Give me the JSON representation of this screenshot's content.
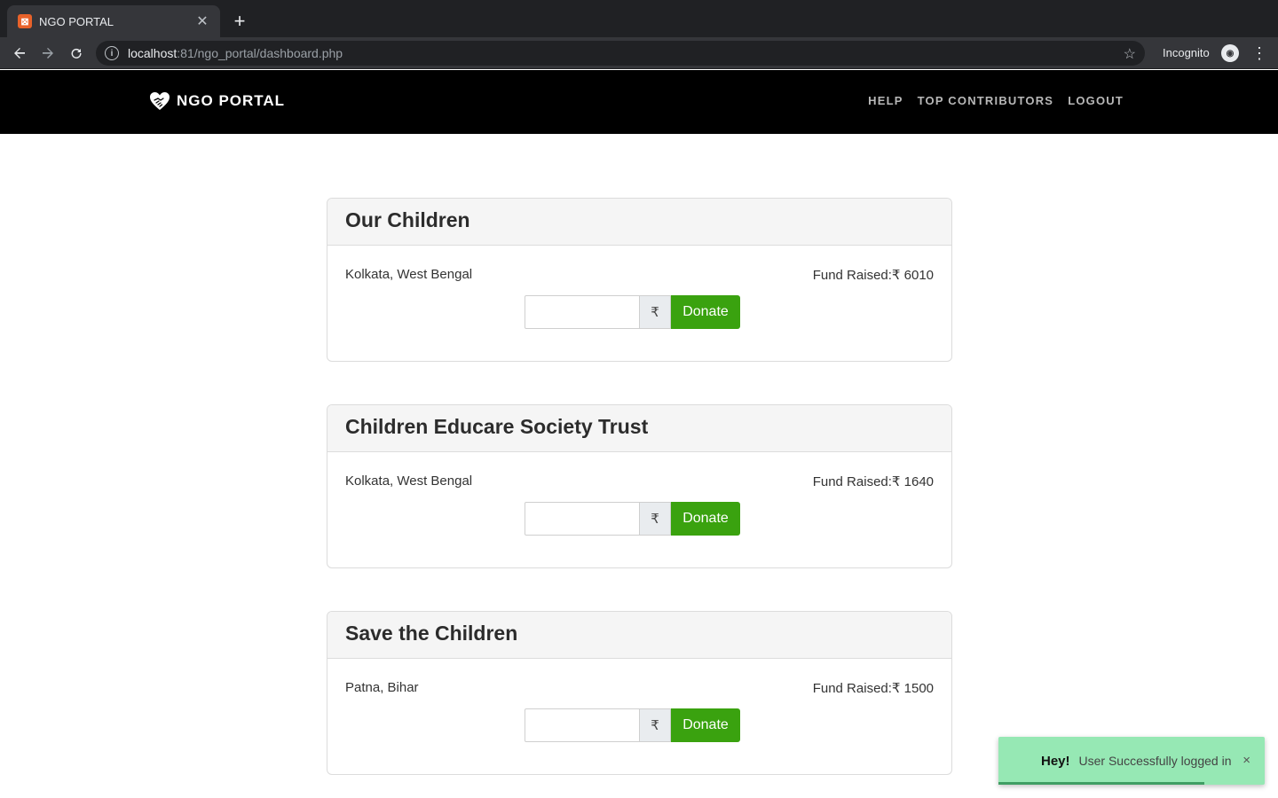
{
  "browser": {
    "tab_title": "NGO PORTAL",
    "tab_favicon_icon": "xampp-icon",
    "url_host": "localhost",
    "url_rest": ":81/ngo_portal/dashboard.php",
    "profile_label": "Incognito"
  },
  "navbar": {
    "brand": "NGO PORTAL",
    "links": [
      "HELP",
      "TOP CONTRIBUTORS",
      "LOGOUT"
    ]
  },
  "cards": [
    {
      "title": "Our Children",
      "location": "Kolkata, West Bengal",
      "fund": "Fund Raised:₹ 6010",
      "currency": "₹",
      "button": "Donate",
      "amount": ""
    },
    {
      "title": "Children Educare Society Trust",
      "location": "Kolkata, West Bengal",
      "fund": "Fund Raised:₹ 1640",
      "currency": "₹",
      "button": "Donate",
      "amount": ""
    },
    {
      "title": "Save the Children",
      "location": "Patna, Bihar",
      "fund": "Fund Raised:₹ 1500",
      "currency": "₹",
      "button": "Donate",
      "amount": ""
    }
  ],
  "toast": {
    "heading": "Hey!",
    "message": "User Successfully logged in",
    "close": "×"
  },
  "colors": {
    "donate_button": "#3aa20f",
    "toast_bg": "#96e8b4",
    "navbar_bg": "#000000"
  }
}
